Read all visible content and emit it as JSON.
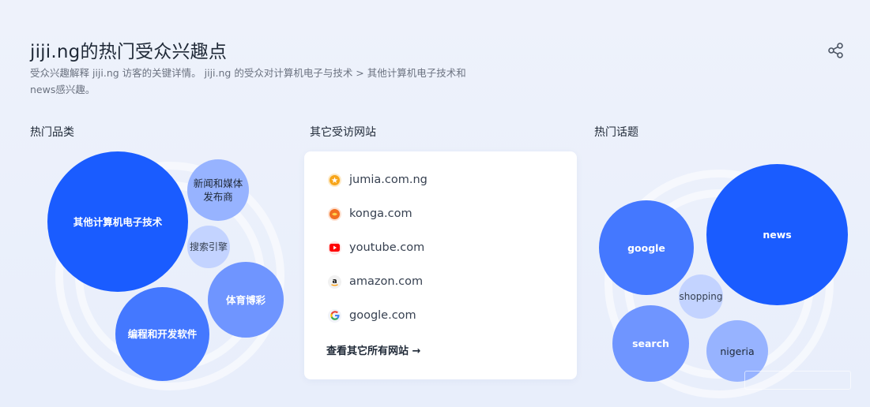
{
  "header": {
    "title": "jiji.ng的热门受众兴趣点",
    "subtitle": "受众兴趣解释 jiji.ng 访客的关键详情。 jiji.ng 的受众对计算机电子与技术 > 其他计算机电子技术和news感兴趣。"
  },
  "sections": {
    "categories_label": "热门品类",
    "sites_label": "其它受访网站",
    "topics_label": "热门话题"
  },
  "categories": [
    {
      "label": "其他计算机电子技术"
    },
    {
      "label": "新闻和媒体发布商"
    },
    {
      "label": "搜索引擎"
    },
    {
      "label": "体育博彩"
    },
    {
      "label": "编程和开发软件"
    }
  ],
  "sites": [
    {
      "name": "jumia.com.ng",
      "icon": "star-icon",
      "color": "#f7a51a"
    },
    {
      "name": "konga.com",
      "icon": "konga-icon",
      "color": "#f26f21"
    },
    {
      "name": "youtube.com",
      "icon": "play-icon",
      "color": "#ff0000"
    },
    {
      "name": "amazon.com",
      "icon": "amazon-icon",
      "color": "#111111"
    },
    {
      "name": "google.com",
      "icon": "google-g-icon",
      "color": "#4285f4"
    }
  ],
  "see_all_label": "查看其它所有网站 →",
  "topics": [
    {
      "label": "google"
    },
    {
      "label": "news"
    },
    {
      "label": "shopping"
    },
    {
      "label": "search"
    },
    {
      "label": "nigeria"
    }
  ]
}
